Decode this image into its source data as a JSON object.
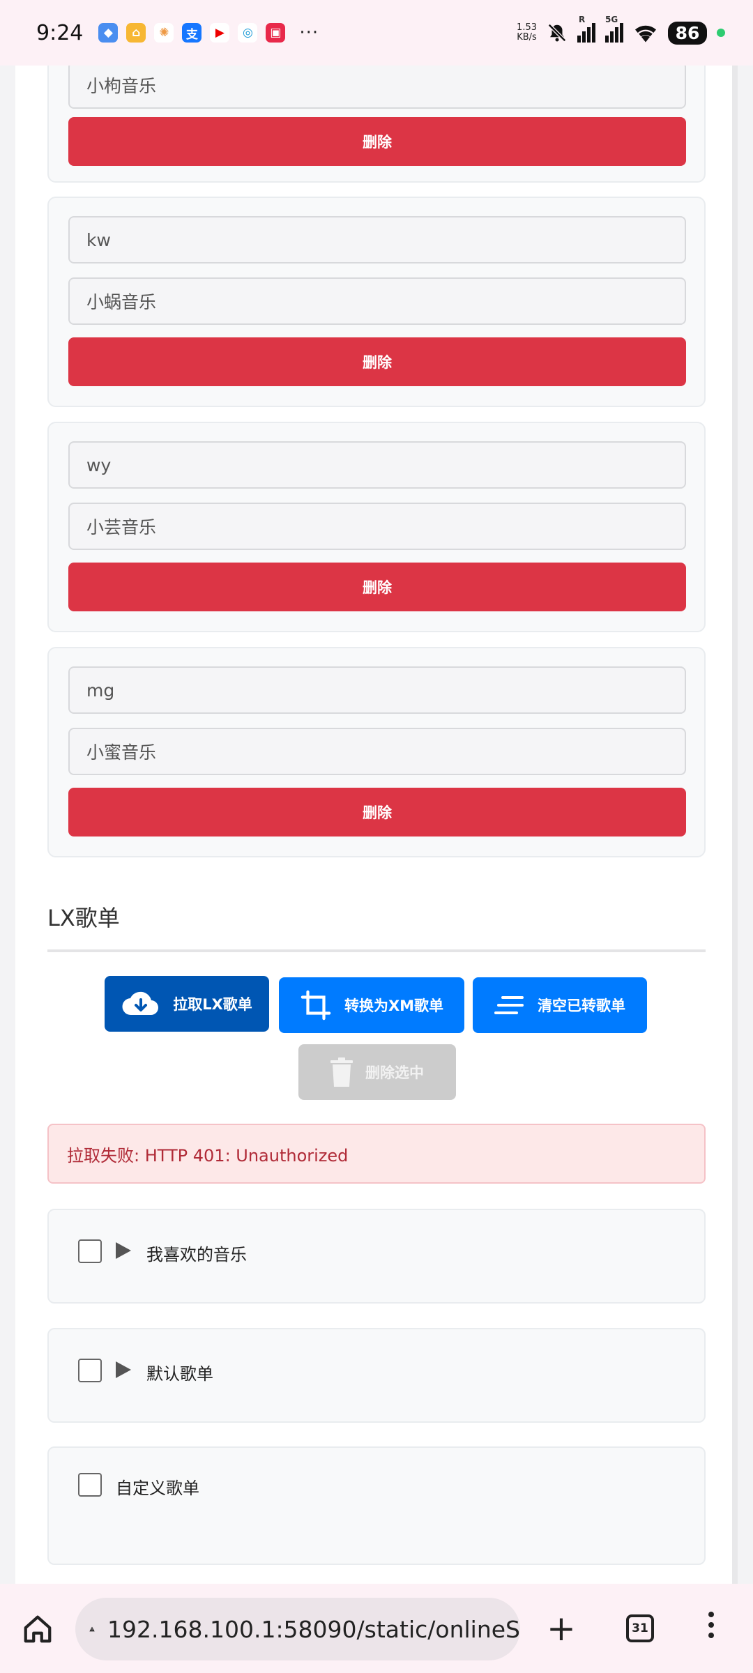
{
  "status_bar": {
    "time": "9:24",
    "net_speed_value": "1.53",
    "net_speed_unit": "KB/s",
    "signal_label": "5G",
    "roaming_label": "R",
    "battery": "86",
    "more": "···"
  },
  "sources": [
    {
      "code": "",
      "name": "小枸音乐",
      "delete_label": "删除"
    },
    {
      "code": "kw",
      "name": "小蜗音乐",
      "delete_label": "删除"
    },
    {
      "code": "wy",
      "name": "小芸音乐",
      "delete_label": "删除"
    },
    {
      "code": "mg",
      "name": "小蜜音乐",
      "delete_label": "删除"
    }
  ],
  "lx_section": {
    "title": "LX歌单",
    "buttons": {
      "fetch": "拉取LX歌单",
      "convert": "转换为XM歌单",
      "clear": "清空已转歌单",
      "delete_selected": "删除选中"
    },
    "error": "拉取失败: HTTP 401: Unauthorized",
    "playlists": [
      {
        "name": "我喜欢的音乐"
      },
      {
        "name": "默认歌单"
      },
      {
        "name": "自定义歌单"
      }
    ]
  },
  "browser": {
    "url": "192.168.100.1:58090/static/onlineS",
    "tab_count": "31"
  }
}
